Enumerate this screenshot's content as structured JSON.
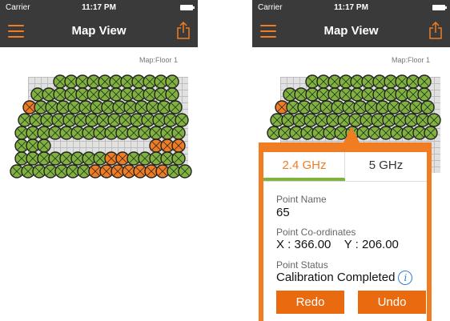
{
  "screens": [
    {
      "status": {
        "carrier": "Carrier",
        "time": "11:17 PM"
      },
      "nav": {
        "title": "Map View"
      },
      "map_label": "Map:Floor 1"
    },
    {
      "status": {
        "carrier": "Carrier",
        "time": "11:17 PM"
      },
      "nav": {
        "title": "Map View"
      },
      "map_label": "Map:Floor 1",
      "popup": {
        "tabs": [
          {
            "label": "2.4 GHz",
            "selected": true
          },
          {
            "label": "5 GHz",
            "selected": false
          }
        ],
        "point_name_label": "Point Name",
        "point_name_value": "65",
        "coords_label": "Point Co-ordinates",
        "coords_value": "X : 366.00    Y : 206.00",
        "status_label": "Point Status",
        "status_value": "Calibration Completed",
        "redo_label": "Redo",
        "undo_label": "Undo"
      }
    }
  ],
  "colors": {
    "accent": "#f07d22",
    "bar": "#3a3a3a",
    "point_done": "#7fb33e",
    "point_pending": "#f07d22",
    "tab_indicator": "#7fb33e"
  },
  "icons": {
    "menu": "hamburger-menu-icon",
    "share": "share-export-icon",
    "info": "info-icon"
  }
}
